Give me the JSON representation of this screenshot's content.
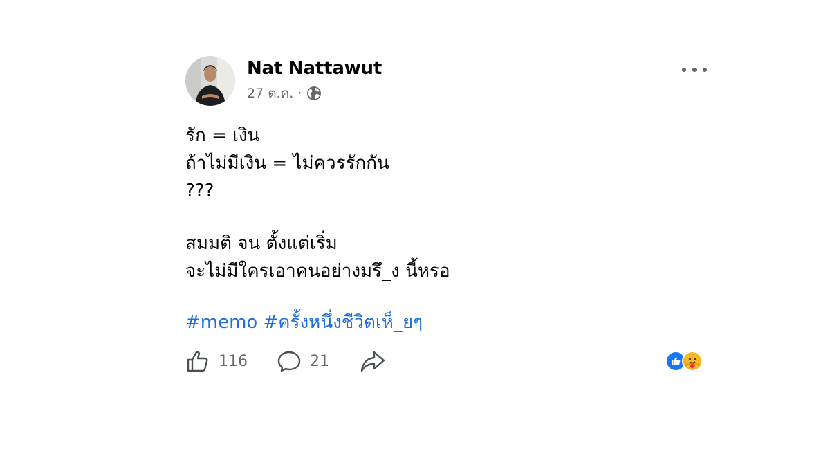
{
  "post": {
    "author": "Nat Nattawut",
    "date": "27 ต.ค.",
    "separator": "·",
    "privacy_icon": "globe-icon",
    "body_lines": [
      "รัก = เงิน",
      "ถ้าไม่มีเงิน = ไม่ควรรักกัน",
      "???",
      "สมมติ จน ตั้งแต่เริ่ม",
      "จะไม่มีใครเอาคนอย่างมรึ_ง นี้หรอ"
    ],
    "hashtags": [
      "#memo",
      "#ครั้งหนึ่งชีวิตเห็_ยๆ"
    ]
  },
  "actions": {
    "likes": "116",
    "comments": "21"
  },
  "reactions": [
    "like-reaction-icon",
    "care-reaction-icon"
  ],
  "colors": {
    "link": "#216fdb",
    "secondary_text": "#65676b",
    "like_blue": "#1877f2",
    "care_yellow": "#f7b928"
  }
}
